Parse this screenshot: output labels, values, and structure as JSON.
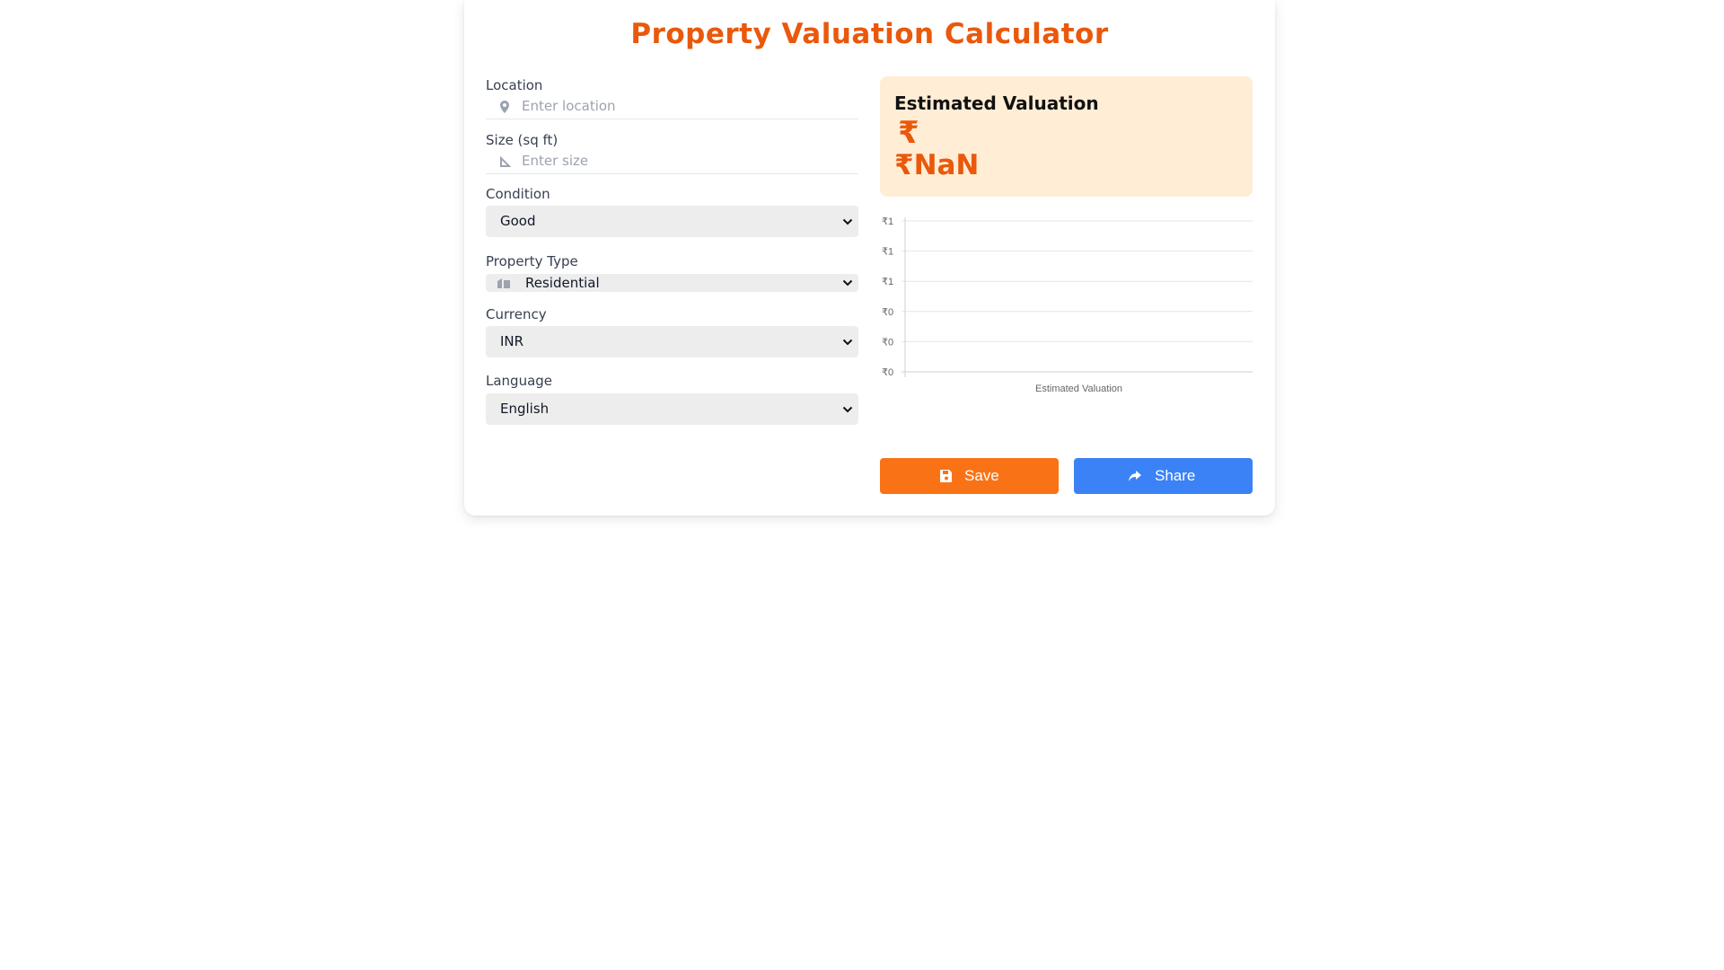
{
  "page": {
    "title": "Property Valuation Calculator"
  },
  "form": {
    "location": {
      "label": "Location",
      "placeholder": "Enter location",
      "value": ""
    },
    "size": {
      "label": "Size (sq ft)",
      "placeholder": "Enter size",
      "value": ""
    },
    "condition": {
      "label": "Condition",
      "selected": "Good"
    },
    "property_type": {
      "label": "Property Type",
      "selected": "Residential"
    },
    "currency": {
      "label": "Currency",
      "selected": "INR"
    },
    "language": {
      "label": "Language",
      "selected": "English"
    }
  },
  "result": {
    "title": "Estimated Valuation",
    "symbol": "₹",
    "value": "₹NaN"
  },
  "chart_data": {
    "type": "bar",
    "categories": [
      "Estimated Valuation"
    ],
    "values": [
      null
    ],
    "y_tick_labels": [
      "₹0",
      "₹0",
      "₹0",
      "₹1",
      "₹1",
      "₹1"
    ],
    "xlabel": "",
    "ylabel": "",
    "grid": true
  },
  "actions": {
    "save_label": "Save",
    "share_label": "Share"
  },
  "colors": {
    "accent": "#ea580c",
    "save_button": "#f97316",
    "share_button": "#3b82f6",
    "result_bg": "#ffedd5"
  },
  "icons": {
    "location": "map-pin-icon",
    "size": "ruler-triangle-icon",
    "property_type": "buildings-icon",
    "save": "floppy-disk-icon",
    "share": "share-arrow-icon",
    "dropdown": "chevron-down-icon"
  }
}
